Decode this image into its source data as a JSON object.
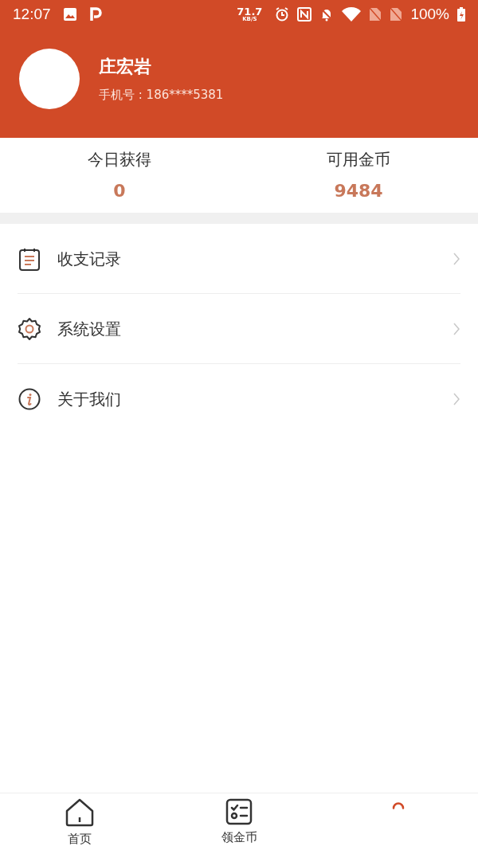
{
  "status_bar": {
    "time": "12:07",
    "speed": "71.7",
    "speed_unit": "KB/S",
    "battery": "100%"
  },
  "profile": {
    "name": "庄宏岩",
    "phone": "手机号 : 186****5381"
  },
  "stats": [
    {
      "label": "今日获得",
      "value": "0"
    },
    {
      "label": "可用金币",
      "value": "9484"
    }
  ],
  "menu": [
    {
      "kind": "records",
      "label": "收支记录"
    },
    {
      "kind": "settings",
      "label": "系统设置"
    },
    {
      "kind": "about",
      "label": "关于我们"
    }
  ],
  "tabs": [
    {
      "kind": "home",
      "label": "首页",
      "selected": false
    },
    {
      "kind": "tasks",
      "label": "领金币",
      "selected": false
    },
    {
      "kind": "profile",
      "selected": true
    }
  ]
}
